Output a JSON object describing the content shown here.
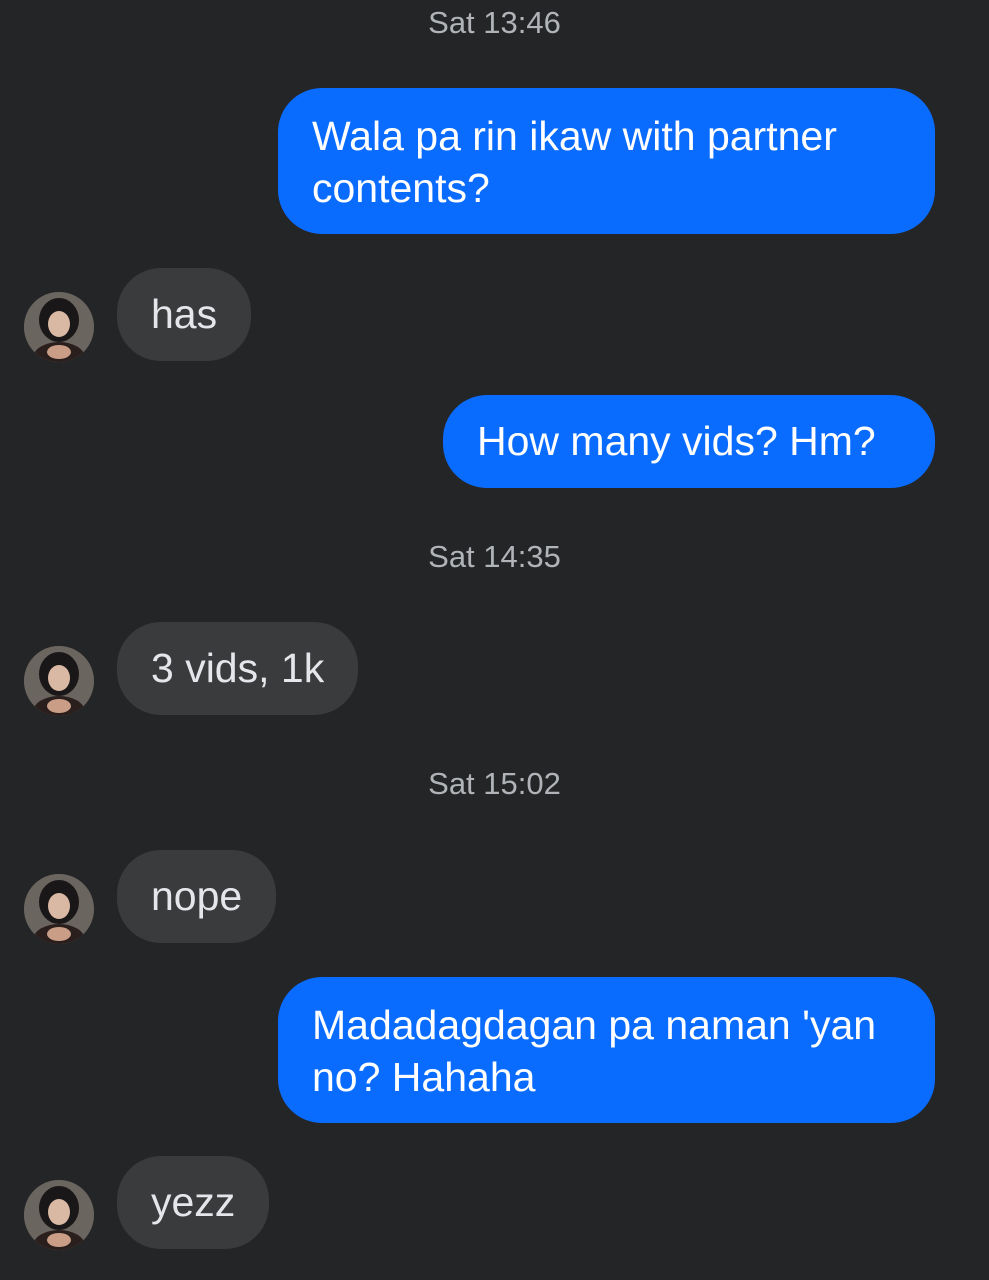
{
  "conversation": {
    "timestamps": [
      "Sat 13:46",
      "Sat 14:35",
      "Sat 15:02"
    ],
    "messages": [
      {
        "from": "me",
        "text": "Wala pa rin ikaw with partner contents?"
      },
      {
        "from": "them",
        "text": "has"
      },
      {
        "from": "me",
        "text": "How many vids? Hm?"
      },
      {
        "from": "them",
        "text": "3 vids, 1k"
      },
      {
        "from": "them",
        "text": "nope"
      },
      {
        "from": "me",
        "text": "Madadagdagan pa naman 'yan no? Hahaha"
      },
      {
        "from": "them",
        "text": "yezz"
      }
    ]
  },
  "colors": {
    "background": "#242526",
    "outgoing_bubble": "#0a6cff",
    "incoming_bubble": "#3a3b3c",
    "timestamp_text": "#b0b3b8"
  },
  "icons": {
    "avatar": "contact-avatar-photo"
  }
}
